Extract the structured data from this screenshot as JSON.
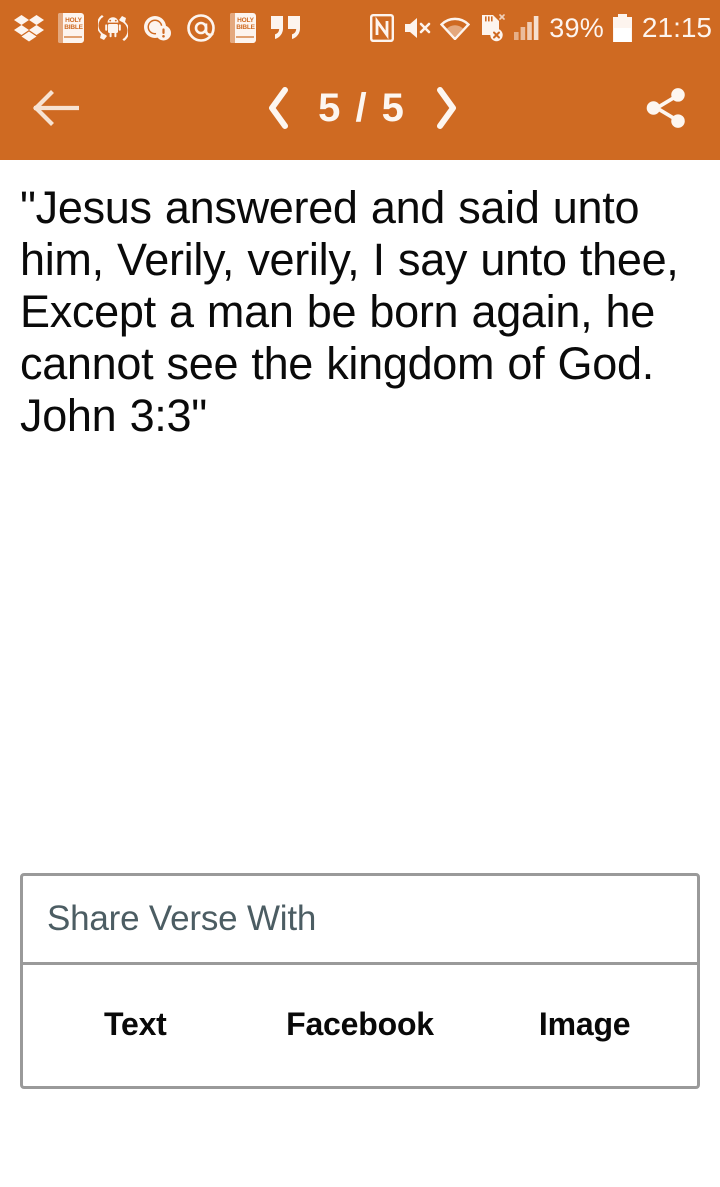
{
  "status_bar": {
    "time": "21:15",
    "battery_percent": "39%",
    "background_color": "#cf6a22",
    "foreground_color": "#fdf4ee",
    "left_icons": [
      {
        "name": "dropbox-icon",
        "label": "Dropbox"
      },
      {
        "name": "holy-bible-icon",
        "label": "HOLY BIBLE",
        "line1": "HOLY",
        "line2": "BIBLE"
      },
      {
        "name": "android-sync-icon",
        "label": "Android System Update"
      },
      {
        "name": "alert-circle-icon",
        "label": "Notification Alert"
      },
      {
        "name": "email-at-icon",
        "label": "Email"
      },
      {
        "name": "holy-bible-icon-2",
        "label": "HOLY BIBLE",
        "line1": "HOLY",
        "line2": "BIBLE"
      },
      {
        "name": "quote-icon",
        "label": "Quote"
      }
    ],
    "right_icons": [
      {
        "name": "nfc-icon",
        "label": "NFC"
      },
      {
        "name": "mute-icon",
        "label": "Sound Muted"
      },
      {
        "name": "wifi-icon",
        "label": "Wi-Fi"
      },
      {
        "name": "sd-card-removed-icon",
        "label": "SD Card Removed"
      },
      {
        "name": "signal-bars-icon",
        "label": "Cellular Signal"
      }
    ]
  },
  "toolbar": {
    "back_label": "Back",
    "prev_label": "Previous Verse",
    "next_label": "Next Verse",
    "counter": "5 / 5",
    "share_label": "Share",
    "background_color": "#cf6a22"
  },
  "verse": {
    "text": "\"Jesus answered and said unto him, Verily, verily, I say unto thee, Except a man be born again, he cannot see the kingdom of God. John 3:3\"",
    "reference": "John 3:3",
    "text_color": "#0a0a0a"
  },
  "share_panel": {
    "header": "Share Verse With",
    "header_color": "#4c5d63",
    "border_color": "#9a9a9a",
    "buttons": [
      {
        "name": "share-text-button",
        "label": "Text"
      },
      {
        "name": "share-facebook-button",
        "label": "Facebook"
      },
      {
        "name": "share-image-button",
        "label": "Image"
      }
    ]
  }
}
